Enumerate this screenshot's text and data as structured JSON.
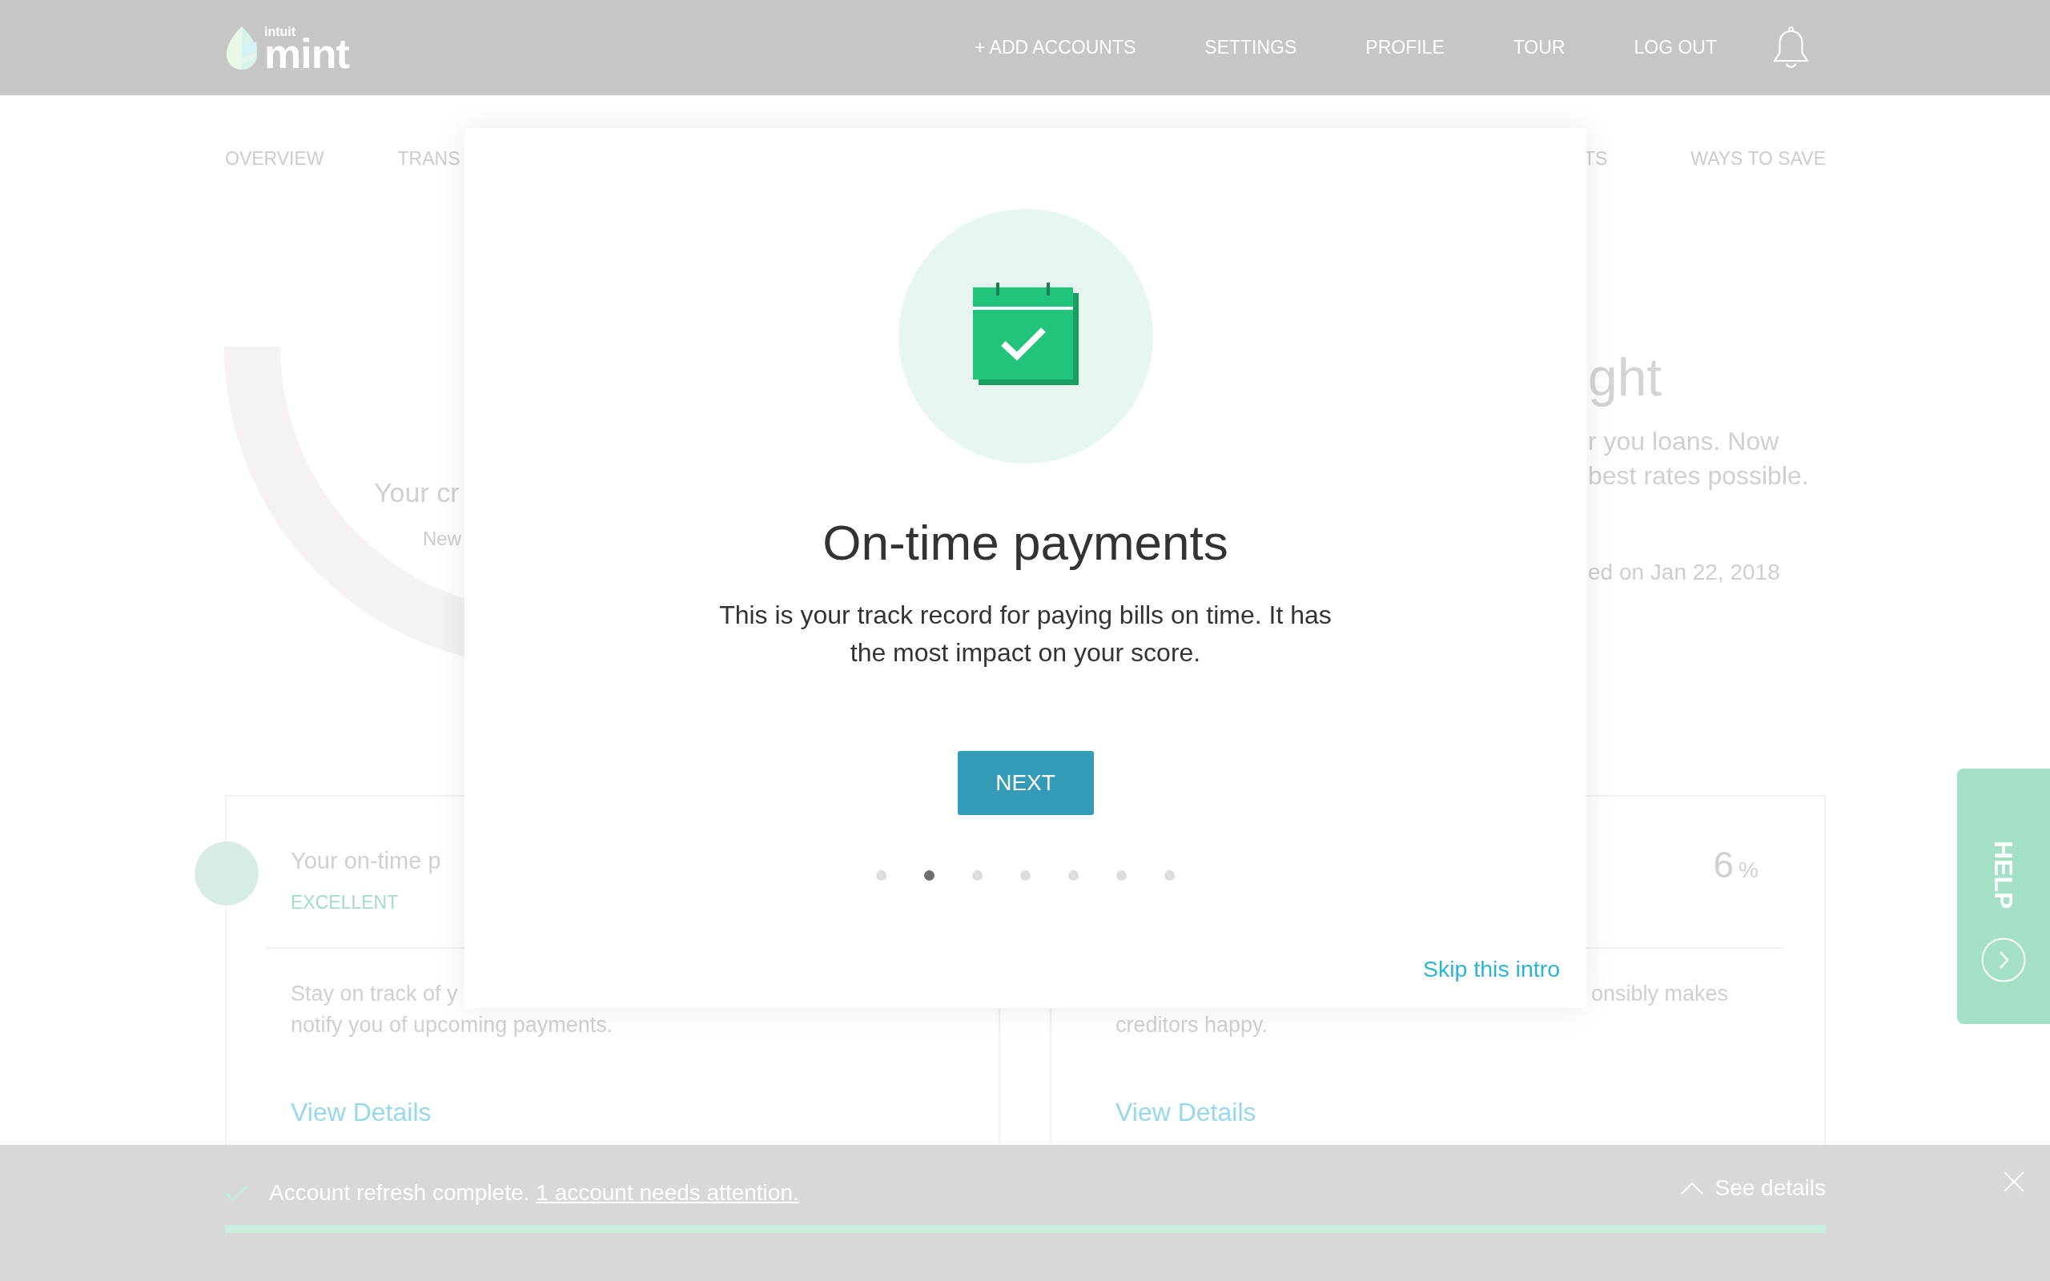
{
  "header": {
    "logo": {
      "small_text": "intuit",
      "name": "mint"
    },
    "nav": [
      "+ ADD ACCOUNTS",
      "SETTINGS",
      "PROFILE",
      "TOUR",
      "LOG OUT"
    ]
  },
  "tabs": [
    {
      "label": "OVERVIEW",
      "selected": false
    },
    {
      "label": "TRANS",
      "selected": false
    },
    {
      "label": "TS",
      "selected": false
    },
    {
      "label": "WAYS TO SAVE",
      "selected": false
    }
  ],
  "score_panel": {
    "caption": "Your cr",
    "note": "New"
  },
  "insight_panel": {
    "title": "ght",
    "text_lines": [
      "r you loans. Now",
      "best rates possible."
    ],
    "updated": "ed on Jan 22, 2018"
  },
  "factor_cards": [
    {
      "kind": "rated",
      "title": "Your on-time p",
      "rating": "EXCELLENT",
      "description_lines": [
        "Stay on track of y",
        "notify you of upcoming payments."
      ],
      "link": "View Details"
    },
    {
      "kind": "percent",
      "value": "6",
      "unit": "%",
      "description_lines": [
        "onsibly makes",
        "creditors happy."
      ],
      "link": "View Details"
    }
  ],
  "modal": {
    "title": "On-time payments",
    "body": "This is your track record for paying bills on time. It has the most impact on your score.",
    "button": "NEXT",
    "pager": [
      {
        "selected": false
      },
      {
        "selected": true
      },
      {
        "selected": false
      },
      {
        "selected": false
      },
      {
        "selected": false
      },
      {
        "selected": false
      },
      {
        "selected": false
      }
    ],
    "skip_link": "Skip this intro"
  },
  "help_tab": {
    "label": "HELP"
  },
  "notification_bar": {
    "message": "Account refresh complete.",
    "link": "1 account needs attention.",
    "details_button": "See details",
    "progress": {
      "level": 1
    }
  }
}
